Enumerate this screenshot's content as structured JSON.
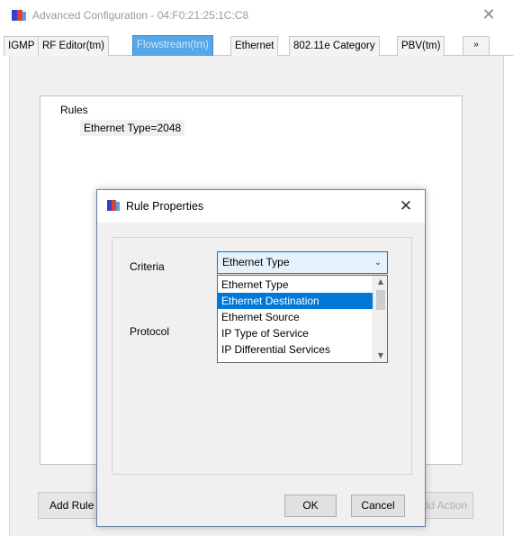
{
  "window": {
    "title": "Advanced Configuration - 04:F0:21:25:1C:C8",
    "icon": "app-flag-icon"
  },
  "tabs": [
    {
      "label": "IGMP"
    },
    {
      "label": "RF Editor(tm)"
    },
    {
      "label": "Flowstream(tm)",
      "active": true
    },
    {
      "label": "Ethernet"
    },
    {
      "label": "802.11e Category"
    },
    {
      "label": "PBV(tm)"
    }
  ],
  "tab_scroll_label": "»",
  "rules_tree": {
    "root_label": "Rules",
    "items": [
      "Ethernet Type=2048"
    ]
  },
  "background_buttons": {
    "add_rule": "Add Rule",
    "add_action": "Add Action"
  },
  "dialog": {
    "title": "Rule Properties",
    "criteria_label": "Criteria",
    "protocol_label": "Protocol",
    "criteria_value": "Ethernet Type",
    "options": [
      "Ethernet Type",
      "Ethernet Destination",
      "Ethernet Source",
      "IP Type of Service",
      "IP Differential Services"
    ],
    "selected_option_index": 1,
    "ok_label": "OK",
    "cancel_label": "Cancel"
  },
  "colors": {
    "active_tab": "#55a7e8",
    "selection": "#0078d7",
    "combo_focus": "#e5f1fb"
  }
}
